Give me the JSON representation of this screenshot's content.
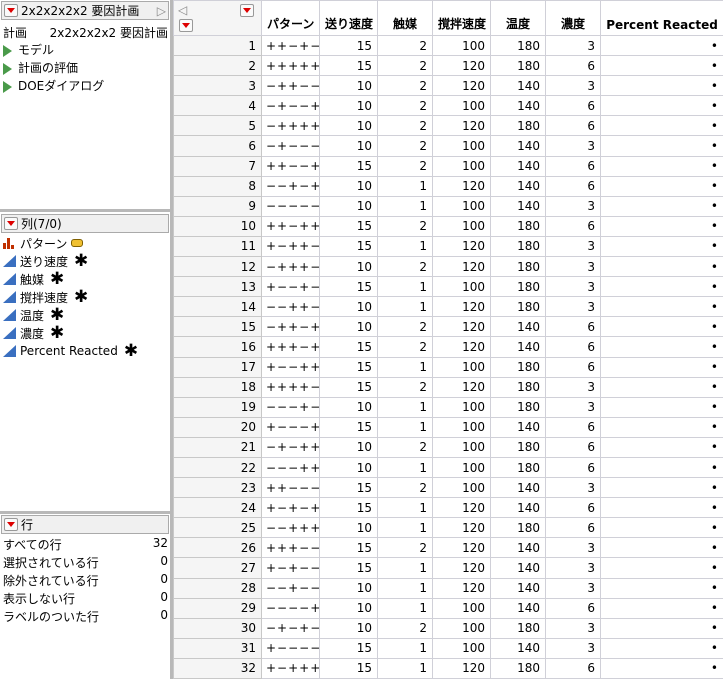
{
  "design_panel": {
    "title": "2x2x2x2x2 要因計画",
    "label": "計画",
    "value": "2x2x2x2x2 要因計画",
    "items": [
      "モデル",
      "計画の評価",
      "DOEダイアログ"
    ]
  },
  "columns_panel": {
    "title": "列(7/0)",
    "columns": [
      {
        "name": "パターン",
        "type": "nominal",
        "tag": true,
        "star": false
      },
      {
        "name": "送り速度",
        "type": "continuous",
        "star": true
      },
      {
        "name": "触媒",
        "type": "continuous",
        "star": true
      },
      {
        "name": "撹拌速度",
        "type": "continuous",
        "star": true
      },
      {
        "name": "温度",
        "type": "continuous",
        "star": true
      },
      {
        "name": "濃度",
        "type": "continuous",
        "star": true
      },
      {
        "name": "Percent Reacted",
        "type": "continuous",
        "star": true
      }
    ],
    "star_symbol": "✱"
  },
  "rows_panel": {
    "title": "行",
    "items": [
      {
        "label": "すべての行",
        "value": "32"
      },
      {
        "label": "選択されている行",
        "value": "0"
      },
      {
        "label": "除外されている行",
        "value": "0"
      },
      {
        "label": "表示しない行",
        "value": "0"
      },
      {
        "label": "ラベルのついた行",
        "value": "0"
      }
    ]
  },
  "table": {
    "headers": [
      "パターン",
      "送り速度",
      "触媒",
      "撹拌速度",
      "温度",
      "濃度",
      "Percent Reacted"
    ],
    "missing": "•",
    "rows": [
      [
        "++−+−",
        15,
        2,
        100,
        180,
        3
      ],
      [
        "+++++",
        15,
        2,
        120,
        180,
        6
      ],
      [
        "−++−−",
        10,
        2,
        120,
        140,
        3
      ],
      [
        "−+−−+",
        10,
        2,
        100,
        140,
        6
      ],
      [
        "−++++",
        10,
        2,
        120,
        180,
        6
      ],
      [
        "−+−−−",
        10,
        2,
        100,
        140,
        3
      ],
      [
        "++−−+",
        15,
        2,
        100,
        140,
        6
      ],
      [
        "−−+−+",
        10,
        1,
        120,
        140,
        6
      ],
      [
        "−−−−−",
        10,
        1,
        100,
        140,
        3
      ],
      [
        "++−++",
        15,
        2,
        100,
        180,
        6
      ],
      [
        "+−++−",
        15,
        1,
        120,
        180,
        3
      ],
      [
        "−+++−",
        10,
        2,
        120,
        180,
        3
      ],
      [
        "+−−+−",
        15,
        1,
        100,
        180,
        3
      ],
      [
        "−−++−",
        10,
        1,
        120,
        180,
        3
      ],
      [
        "−++−+",
        10,
        2,
        120,
        140,
        6
      ],
      [
        "+++−+",
        15,
        2,
        120,
        140,
        6
      ],
      [
        "+−−++",
        15,
        1,
        100,
        180,
        6
      ],
      [
        "++++−",
        15,
        2,
        120,
        180,
        3
      ],
      [
        "−−−+−",
        10,
        1,
        100,
        180,
        3
      ],
      [
        "+−−−+",
        15,
        1,
        100,
        140,
        6
      ],
      [
        "−+−++",
        10,
        2,
        100,
        180,
        6
      ],
      [
        "−−−++",
        10,
        1,
        100,
        180,
        6
      ],
      [
        "++−−−",
        15,
        2,
        100,
        140,
        3
      ],
      [
        "+−+−+",
        15,
        1,
        120,
        140,
        6
      ],
      [
        "−−+++",
        10,
        1,
        120,
        180,
        6
      ],
      [
        "+++−−",
        15,
        2,
        120,
        140,
        3
      ],
      [
        "+−+−−",
        15,
        1,
        120,
        140,
        3
      ],
      [
        "−−+−−",
        10,
        1,
        120,
        140,
        3
      ],
      [
        "−−−−+",
        10,
        1,
        100,
        140,
        6
      ],
      [
        "−+−+−",
        10,
        2,
        100,
        180,
        3
      ],
      [
        "+−−−−",
        15,
        1,
        100,
        140,
        3
      ],
      [
        "+−+++",
        15,
        1,
        120,
        180,
        6
      ]
    ]
  }
}
